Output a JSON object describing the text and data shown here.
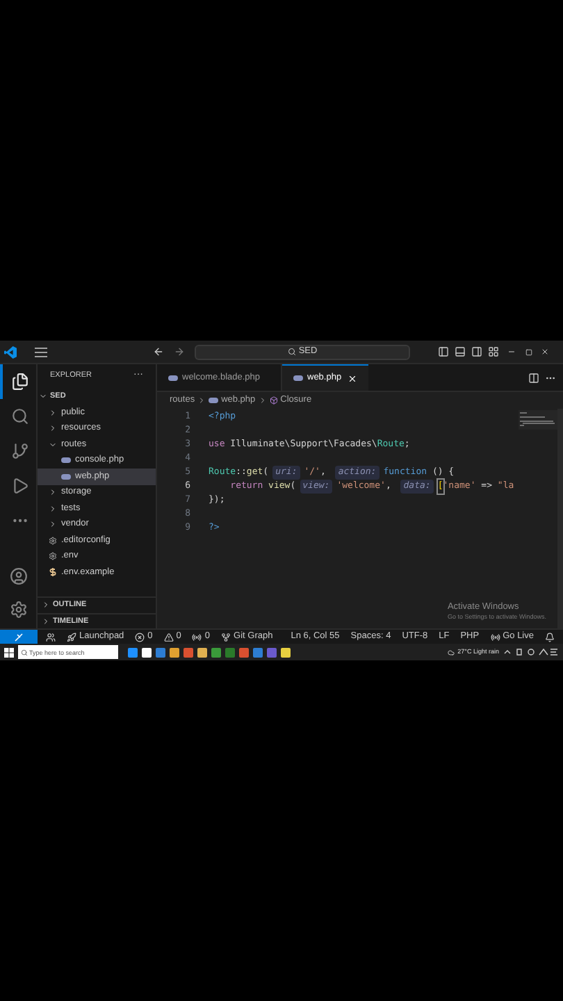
{
  "title_bar": {
    "search": "SED"
  },
  "activity_bar": [
    {
      "kind": "files",
      "selected": true
    },
    {
      "kind": "search",
      "selected": false
    },
    {
      "kind": "source-control",
      "selected": false
    },
    {
      "kind": "run",
      "selected": false
    },
    {
      "kind": "more",
      "selected": false
    }
  ],
  "activity_bottom": [
    {
      "kind": "account"
    },
    {
      "kind": "settings"
    }
  ],
  "sidebar": {
    "title": "EXPLORER",
    "more": "···",
    "folder": "SED",
    "items": [
      {
        "name": "public",
        "kind": "folder",
        "expanded": false,
        "selected": false
      },
      {
        "name": "resources",
        "kind": "folder",
        "expanded": false,
        "selected": false
      },
      {
        "name": "routes",
        "kind": "folder",
        "expanded": true,
        "selected": false,
        "children": [
          {
            "name": "console.php",
            "kind": "php",
            "selected": false
          },
          {
            "name": "web.php",
            "kind": "php",
            "selected": true
          }
        ]
      },
      {
        "name": "storage",
        "kind": "folder",
        "expanded": false,
        "selected": false
      },
      {
        "name": "tests",
        "kind": "folder",
        "expanded": false,
        "selected": false
      },
      {
        "name": "vendor",
        "kind": "folder",
        "expanded": false,
        "selected": false
      },
      {
        "name": ".editorconfig",
        "kind": "config",
        "selected": false
      },
      {
        "name": ".env",
        "kind": "config",
        "selected": false
      },
      {
        "name": ".env.example",
        "kind": "dollar",
        "selected": false
      }
    ],
    "sections": [
      {
        "name": "OUTLINE"
      },
      {
        "name": "TIMELINE"
      }
    ]
  },
  "tabs": [
    {
      "label": "welcome.blade.php",
      "selected": false
    },
    {
      "label": "web.php",
      "selected": true
    }
  ],
  "breadcrumbs": [
    {
      "label": "routes",
      "kind": "folder"
    },
    {
      "label": "web.php",
      "kind": "php"
    },
    {
      "label": "Closure",
      "kind": "symbol"
    }
  ],
  "code_lines": [
    {
      "number": "1",
      "current": false,
      "tokens": [
        {
          "text": "<?php",
          "kind": "tag"
        }
      ]
    },
    {
      "number": "2",
      "current": false
    },
    {
      "number": "3",
      "current": false,
      "tokens": [
        {
          "text": "use",
          "kind": "keyword"
        },
        {
          "text": " Illuminate\\Support\\Facades\\",
          "kind": "plain"
        },
        {
          "text": "Route",
          "kind": "class"
        },
        {
          "text": ";",
          "kind": "plain"
        }
      ]
    },
    {
      "number": "4",
      "current": false
    },
    {
      "number": "5",
      "current": false,
      "tokens": [
        {
          "text": "Route",
          "kind": "class"
        },
        {
          "text": "::",
          "kind": "plain"
        },
        {
          "text": "get",
          "kind": "fn"
        },
        {
          "text": "(",
          "kind": "plain"
        },
        {
          "text": "uri:",
          "kind": "hint"
        },
        {
          "text": "'/'",
          "kind": "string"
        },
        {
          "text": ", ",
          "kind": "plain"
        },
        {
          "text": "action:",
          "kind": "hint"
        },
        {
          "text": "function",
          "kind": "tag"
        },
        {
          "text": " () {",
          "kind": "plain"
        }
      ]
    },
    {
      "number": "6",
      "current": true,
      "tokens": [
        {
          "text": "    return ",
          "kind": "keyword"
        },
        {
          "text": "view",
          "kind": "fn"
        },
        {
          "text": "(",
          "kind": "plain"
        },
        {
          "text": "view:",
          "kind": "hint"
        },
        {
          "text": "'welcome'",
          "kind": "string"
        },
        {
          "text": ", ",
          "kind": "plain"
        },
        {
          "text": "data:",
          "kind": "hint"
        },
        {
          "text": "[",
          "kind": "bracket"
        },
        {
          "text": "'name'",
          "kind": "string"
        },
        {
          "text": " => ",
          "kind": "plain"
        },
        {
          "text": "\"la",
          "kind": "string"
        }
      ]
    },
    {
      "number": "7",
      "current": false,
      "tokens": [
        {
          "text": "});",
          "kind": "plain"
        }
      ]
    },
    {
      "number": "8",
      "current": false
    },
    {
      "number": "9",
      "current": false,
      "tokens": [
        {
          "text": "?>",
          "kind": "tag"
        }
      ]
    }
  ],
  "status_bar": {
    "left": [
      {
        "kind": "accounts"
      },
      {
        "text": "Launchpad",
        "kind": "launchpad"
      },
      {
        "text": "0",
        "kind": "errors"
      },
      {
        "text": "0",
        "kind": "warnings"
      },
      {
        "text": "0",
        "kind": "ports"
      },
      {
        "text": "Git Graph",
        "kind": "git-graph"
      }
    ],
    "right": [
      {
        "text": "Ln 6, Col 55",
        "kind": "plain"
      },
      {
        "text": "Spaces: 4",
        "kind": "plain"
      },
      {
        "text": "UTF-8",
        "kind": "plain"
      },
      {
        "text": "LF",
        "kind": "plain"
      },
      {
        "text": "PHP",
        "kind": "plain"
      },
      {
        "text": "Go Live",
        "kind": "live"
      },
      {
        "kind": "bell"
      }
    ]
  },
  "activation": {
    "title": "Activate Windows",
    "subtitle": "Go to Settings to activate Windows."
  },
  "taskbar": {
    "search_placeholder": "Type here to search",
    "weather": "27°C Light rain"
  }
}
